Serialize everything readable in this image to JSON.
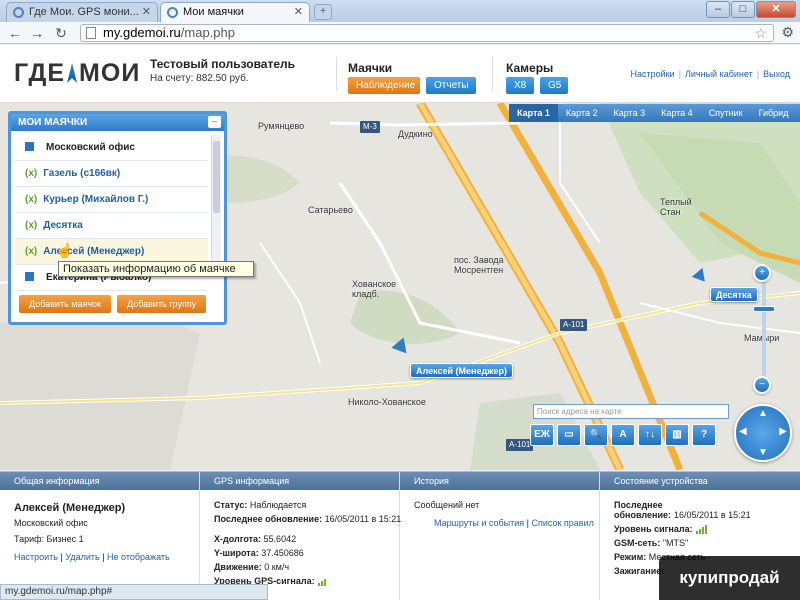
{
  "browser": {
    "tabs": [
      {
        "label": "Где Мои. GPS мони...",
        "active": false
      },
      {
        "label": "Мои маячки",
        "active": true
      }
    ],
    "url_host": "my.gdemoi.ru",
    "url_path": "/map.php",
    "status_text": "my.gdemoi.ru/map.php#"
  },
  "header": {
    "logo_left": "ГДЕ",
    "logo_right": "МОИ",
    "user_name": "Тестовый пользователь",
    "balance": "На счету: 882.50 руб.",
    "beacons_title": "Маячки",
    "observe_label": "Наблюдение",
    "reports_label": "Отчеты",
    "cameras_title": "Камеры",
    "cam1_label": "X8",
    "cam2_label": "G5",
    "links": [
      "Настройки",
      "Личный кабинет",
      "Выход"
    ]
  },
  "map": {
    "tabs": [
      "Карта 1",
      "Карта 2",
      "Карта 3",
      "Карта 4",
      "Спутник",
      "Гибрид"
    ],
    "active_tab": "Карта 1",
    "labels": [
      "Румянцево",
      "Дудкино",
      "Сатарьево",
      "Хованское кладб.",
      "пос. Завода Мосрентген",
      "Николо-Хованское",
      "Теплый Стан",
      "Мамыри"
    ],
    "road_signs": [
      "М-3",
      "А-101",
      "А-101"
    ],
    "markers": [
      "Десятка",
      "Алексей (Менеджер)"
    ],
    "search_placeholder": "Поиск адреса на карте",
    "tools": [
      "ЕЖ",
      "▭",
      "🔍",
      "A",
      "↑↓",
      "▥",
      "?"
    ]
  },
  "beacons_panel": {
    "title": "МОИ МАЯЧКИ",
    "items": [
      {
        "label": "Московский офис",
        "type": "group"
      },
      {
        "label": "Газель (с166вк)",
        "type": "beacon"
      },
      {
        "label": "Курьер (Михайлов Г.)",
        "type": "beacon"
      },
      {
        "label": "Десятка",
        "type": "beacon"
      },
      {
        "label": "Алексей (Менеджер)",
        "type": "beacon"
      },
      {
        "label": "Екатерина (Рыбалко)",
        "type": "group"
      }
    ],
    "add_beacon": "Добавить маячок",
    "add_group": "Добавить группу",
    "tooltip": "Показать информацию об маячке",
    "gps_mark": "(x)"
  },
  "info": {
    "general": {
      "title": "Общая информация",
      "name": "Алексей (Менеджер)",
      "office": "Московский офис",
      "tariff": "Тариф: Бизнес 1",
      "link_settings": "Настроить",
      "link_delete": "Удалить",
      "link_hide": "Не отображать"
    },
    "gps": {
      "title": "GPS информация",
      "status_label": "Статус:",
      "status_value": "Наблюдается",
      "update_label": "Последнее обновление:",
      "update_value": "16/05/2011 в 15:21",
      "x_label": "X-долгота:",
      "x_value": "55.6042",
      "y_label": "Y-широта:",
      "y_value": "37.450686",
      "move_label": "Движение:",
      "move_value": "0 км/ч",
      "signal_label": "Уровень GPS-сигнала:"
    },
    "history": {
      "title": "История",
      "messages": "Сообщений нет",
      "link_routes": "Маршруты и события",
      "link_list": "Список правил"
    },
    "device": {
      "title": "Состояние устройства",
      "update_label": "Последнее обновление:",
      "update_value": "16/05/2011 в 15:21",
      "signal_label": "Уровень сигнала:",
      "gsm_label": "GSM-сеть:",
      "gsm_value": "\"MTS\"",
      "mode_label": "Режим:",
      "mode_value": "Местная сеть",
      "ignition_label": "Зажигание:"
    }
  },
  "watermark": "купипродай",
  "colors": {
    "accent_blue": "#2f7bc6",
    "orange": "#e07614",
    "signal_green": "#6fb52e"
  }
}
